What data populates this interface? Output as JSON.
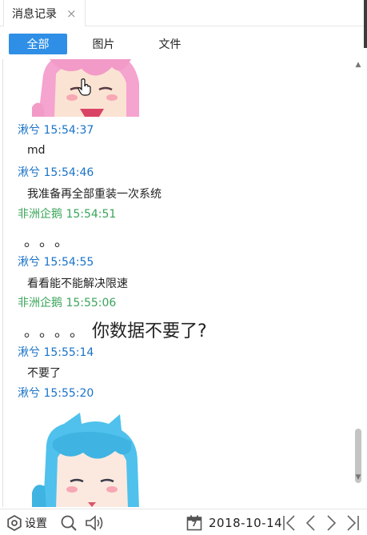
{
  "window_tab": {
    "title": "消息记录",
    "close_icon": "×"
  },
  "filters": [
    {
      "label": "全部",
      "active": true
    },
    {
      "label": "图片",
      "active": false
    },
    {
      "label": "文件",
      "active": false
    }
  ],
  "messages": [
    {
      "sender": "湫兮",
      "time": "15:54:37",
      "color": "#1a73c8",
      "text": "md"
    },
    {
      "sender": "湫兮",
      "time": "15:54:46",
      "color": "#1a73c8",
      "text": "我准备再全部重装一次系统"
    },
    {
      "sender": "非洲企鹅",
      "time": "15:54:51",
      "color": "#3aa55a",
      "text": "。。。"
    },
    {
      "sender": "湫兮",
      "time": "15:54:55",
      "color": "#1a73c8",
      "text": "看看能不能解决限速"
    },
    {
      "sender": "非洲企鹅",
      "time": "15:55:06",
      "color": "#3aa55a",
      "text": "。。。。",
      "text_big": "你数据不要了?"
    },
    {
      "sender": "湫兮",
      "time": "15:55:14",
      "color": "#1a73c8",
      "text": "不要了"
    },
    {
      "sender": "湫兮",
      "time": "15:55:20",
      "color": "#1a73c8"
    }
  ],
  "bottom": {
    "settings_label": "设置",
    "calendar_day": "7",
    "date": "2018-10-14"
  },
  "icons": [
    "settings-icon",
    "search-icon",
    "speaker-icon",
    "calendar-icon",
    "first-page-icon",
    "prev-page-icon",
    "next-page-icon",
    "last-page-icon",
    "scroll-up-icon",
    "scroll-down-icon"
  ],
  "colors": {
    "accent": "#2f8fe6",
    "sender_self": "#1a73c8",
    "sender_other": "#3aa55a"
  }
}
